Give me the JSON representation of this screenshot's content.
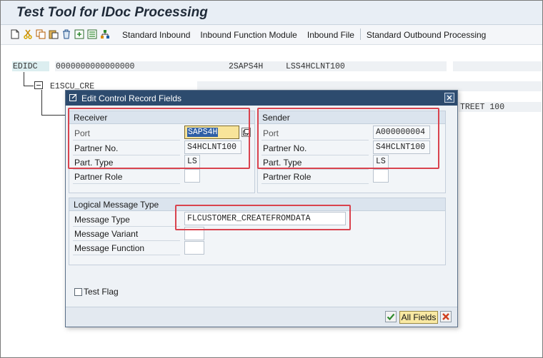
{
  "window": {
    "title": "Test Tool for IDoc Processing"
  },
  "toolbar": {
    "icons": [
      "new-document-icon",
      "cut-icon",
      "copy-icon",
      "paste-icon",
      "delete-icon",
      "insert-icon",
      "append-icon",
      "hierarchy-icon"
    ],
    "items": [
      "Standard Inbound",
      "Inbound Function Module",
      "Inbound File",
      "Standard Outbound Processing"
    ]
  },
  "tree": {
    "edidc_label": "EDIDC",
    "edidc_docnum": "0000000000000000",
    "edidc_receiver": "2SAPS4H",
    "edidc_sender": "LSS4HCLNT100",
    "segment_label": "E1SCU_CRE",
    "street_fragment": "TREET 100"
  },
  "dialog": {
    "title": "Edit Control Record Fields",
    "receiver": {
      "header": "Receiver",
      "port_label": "Port",
      "port_value": "SAPS4H",
      "partner_no_label": "Partner No.",
      "partner_no_value": "S4HCLNT100",
      "part_type_label": "Part. Type",
      "part_type_value": "LS",
      "partner_role_label": "Partner Role",
      "partner_role_value": ""
    },
    "sender": {
      "header": "Sender",
      "port_label": "Port",
      "port_value": "A000000004",
      "partner_no_label": "Partner No.",
      "partner_no_value": "S4HCLNT100",
      "part_type_label": "Part. Type",
      "part_type_value": "LS",
      "partner_role_label": "Partner Role",
      "partner_role_value": ""
    },
    "logical_message": {
      "header": "Logical Message Type",
      "message_type_label": "Message Type",
      "message_type_value": "FLCUSTOMER_CREATEFROMDATA",
      "message_variant_label": "Message Variant",
      "message_variant_value": "",
      "message_function_label": "Message Function",
      "message_function_value": ""
    },
    "test_flag_label": "Test Flag",
    "test_flag_checked": false,
    "buttons": {
      "all_fields": "All Fields"
    }
  },
  "colors": {
    "highlight_box": "#d9434e",
    "dialog_title_bg": "#2d4b6e",
    "selected_field_bg": "#f8e49a"
  }
}
